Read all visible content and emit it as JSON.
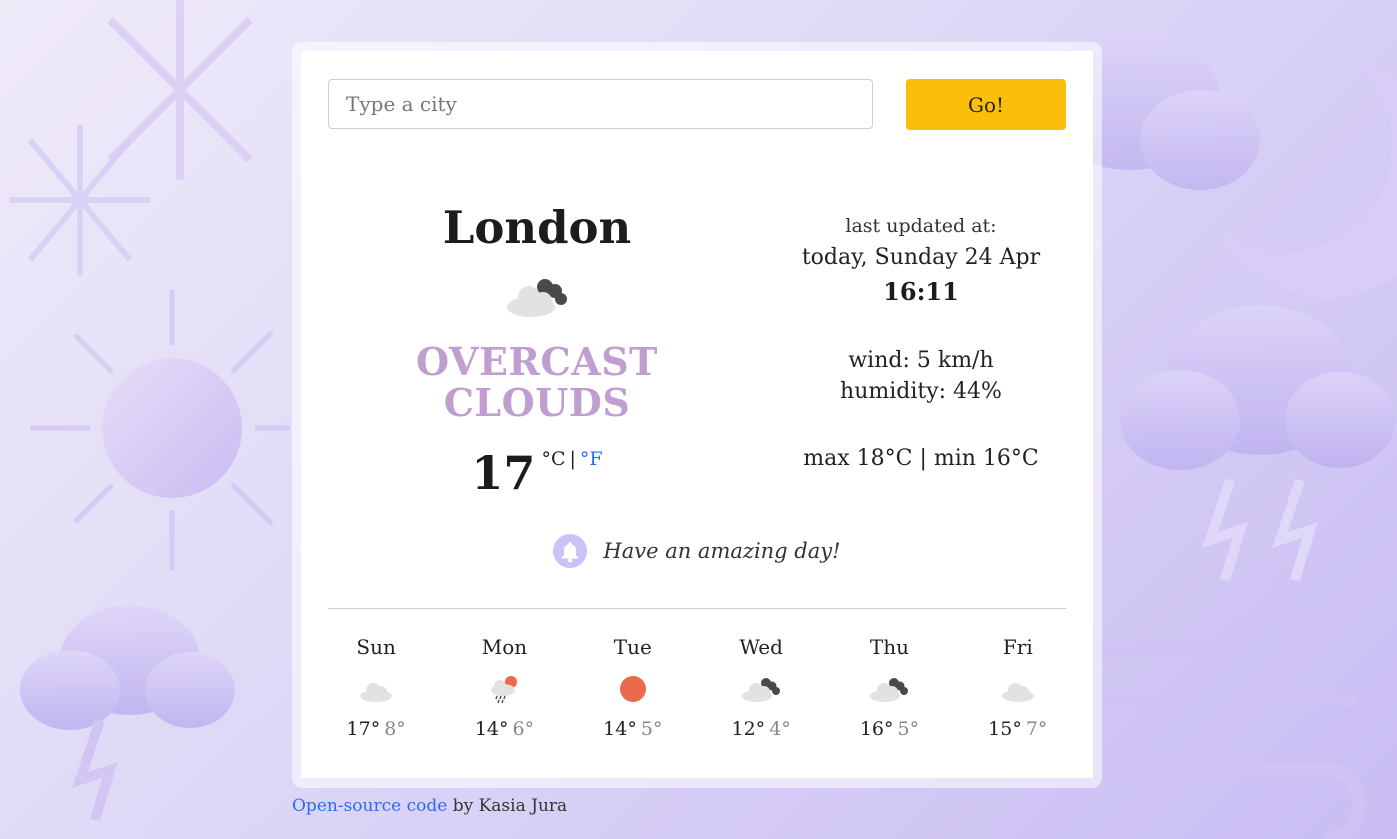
{
  "search": {
    "placeholder": "Type a city",
    "value": "",
    "button_label": "Go!"
  },
  "current": {
    "city": "London",
    "icon": "overcast-clouds-icon",
    "description": "OVERCAST CLOUDS",
    "temperature": "17",
    "unit_c": "°C",
    "unit_separator": "|",
    "unit_f": "°F"
  },
  "details": {
    "updated_label": "last updated at:",
    "updated_date": "today, Sunday 24 Apr",
    "updated_time": "16:11",
    "wind": "wind: 5 km/h",
    "humidity": "humidity: 44%",
    "maxmin": "max 18°C | min 16°C"
  },
  "greeting": {
    "icon": "bell-icon",
    "text": "Have an amazing day!"
  },
  "forecast": [
    {
      "day": "Sun",
      "icon": "cloud-icon",
      "max": "17°",
      "min": "8°"
    },
    {
      "day": "Mon",
      "icon": "rain-sun-icon",
      "max": "14°",
      "min": "6°"
    },
    {
      "day": "Tue",
      "icon": "sun-icon",
      "max": "14°",
      "min": "5°"
    },
    {
      "day": "Wed",
      "icon": "overcast-clouds-icon",
      "max": "12°",
      "min": "4°"
    },
    {
      "day": "Thu",
      "icon": "overcast-clouds-icon",
      "max": "16°",
      "min": "5°"
    },
    {
      "day": "Fri",
      "icon": "cloud-icon",
      "max": "15°",
      "min": "7°"
    }
  ],
  "footer": {
    "link_text": "Open-source code",
    "credit": " by Kasia Jura"
  },
  "colors": {
    "accent_button": "#fbbf0a",
    "description": "#c09ecf",
    "link": "#2a6df4",
    "sun": "#ec6a4c"
  }
}
